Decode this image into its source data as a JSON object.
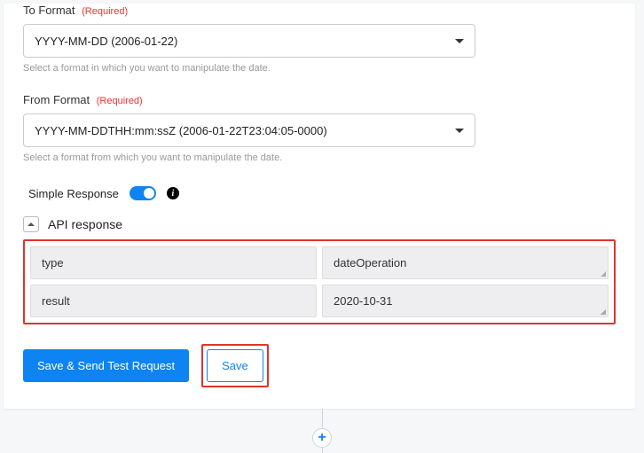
{
  "fields": {
    "toFormat": {
      "label": "To Format",
      "required": "(Required)",
      "value": "YYYY-MM-DD (2006-01-22)",
      "hint": "Select a format in which you want to manipulate the date."
    },
    "fromFormat": {
      "label": "From Format",
      "required": "(Required)",
      "value": "YYYY-MM-DDTHH:mm:ssZ (2006-01-22T23:04:05-0000)",
      "hint": "Select a format from which you want to manipulate the date."
    }
  },
  "simpleResponse": {
    "label": "Simple Response",
    "enabled": true
  },
  "apiResponse": {
    "title": "API response",
    "rows": [
      {
        "key": "type",
        "value": "dateOperation"
      },
      {
        "key": "result",
        "value": "2020-10-31"
      }
    ]
  },
  "buttons": {
    "primary": "Save & Send Test Request",
    "secondary": "Save"
  },
  "addNode": "+"
}
